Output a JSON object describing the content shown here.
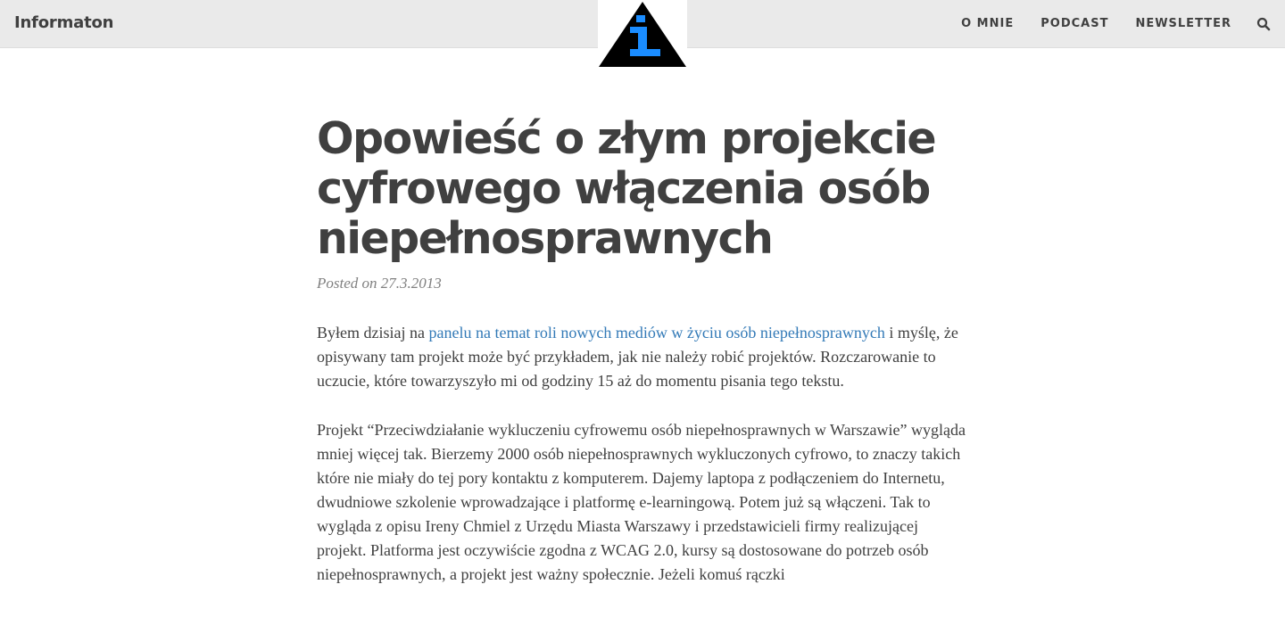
{
  "header": {
    "brand": "Informaton",
    "nav": [
      {
        "label": "O MNIE"
      },
      {
        "label": "PODCAST"
      },
      {
        "label": "NEWSLETTER"
      }
    ],
    "search_icon": "search-icon",
    "logo": {
      "icon": "info-triangle-logo",
      "letter": "i",
      "accent": "#1a8cff"
    }
  },
  "post": {
    "title": "Opowieść o złym projekcie cyfrowego włączenia osób niepełnosprawnych",
    "meta": "Posted on 27.3.2013",
    "p1": {
      "before": "Byłem dzisiaj na ",
      "link_text": "panelu na temat roli nowych mediów w życiu osób niepełnosprawnych",
      "after": " i myślę, że opisywany tam projekt może być przykładem, jak nie należy robić projektów. Rozczarowanie to uczucie, które towarzyszyło mi od godziny 15 aż do momentu pisania tego tekstu."
    },
    "p2": "Projekt “Przeciwdziałanie wykluczeniu cyfrowemu osób niepełnosprawnych w Warszawie” wygląda mniej więcej tak. Bierzemy 2000 osób niepełnosprawnych wykluczonych cyfrowo, to znaczy takich które nie miały do tej pory kontaktu z komputerem. Dajemy laptopa z podłączeniem do Internetu, dwudniowe szkolenie wprowadzające i platformę e-learningową. Potem już są włączeni. Tak to wygląda z opisu Ireny Chmiel z Urzędu Miasta Warszawy i przedstawicieli firmy realizującej projekt. Platforma jest oczywiście zgodna z WCAG 2.0, kursy są dostosowane do potrzeb osób niepełnosprawnych, a projekt jest ważny społecznie. Jeżeli komuś rączki"
  },
  "colors": {
    "topbar": "#eaeaea",
    "text": "#404040",
    "link": "#337ab7",
    "meta": "#808080"
  }
}
